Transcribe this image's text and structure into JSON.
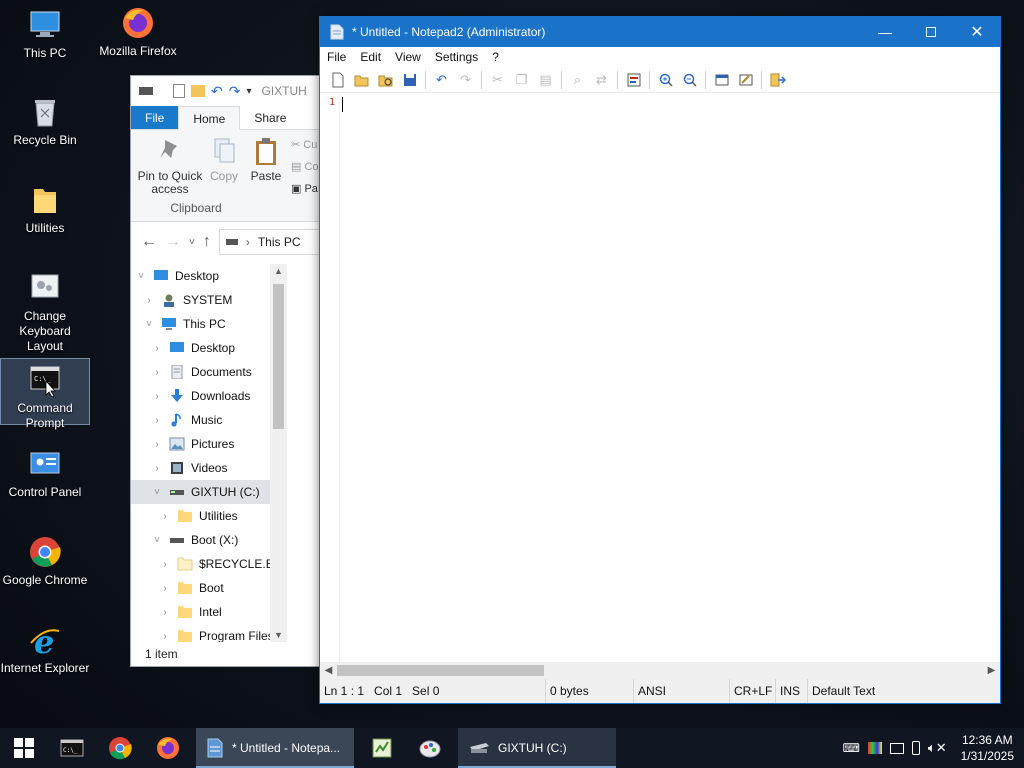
{
  "desktop": {
    "icons": [
      {
        "label": "This PC",
        "icon": "this-pc-icon"
      },
      {
        "label": "Mozilla Firefox",
        "icon": "firefox-icon"
      },
      {
        "label": "Recycle Bin",
        "icon": "recycle-bin-icon"
      },
      {
        "label": "Utilities",
        "icon": "folder-icon"
      },
      {
        "label": "Change Keyboard Layout",
        "icon": "keyboard-settings-icon"
      },
      {
        "label": "Command Prompt",
        "icon": "command-prompt-icon"
      },
      {
        "label": "Control Panel",
        "icon": "control-panel-icon"
      },
      {
        "label": "Google Chrome",
        "icon": "chrome-icon"
      },
      {
        "label": "Internet Explorer",
        "icon": "internet-explorer-icon"
      }
    ]
  },
  "explorer": {
    "qat_title": "GIXTUH",
    "tabs": {
      "file": "File",
      "home": "Home",
      "share": "Share"
    },
    "ribbon": {
      "pin_label": "Pin to Quick access",
      "copy_label": "Copy",
      "paste_label": "Paste",
      "cut_short": "Cu",
      "copy_path_short": "Co",
      "paste_shortcut_short": "Pa",
      "group_label": "Clipboard"
    },
    "address": {
      "location": "This PC"
    },
    "tree": [
      {
        "label": "Desktop",
        "level": 0,
        "chev": "˅"
      },
      {
        "label": "SYSTEM",
        "level": 1,
        "chev": "›"
      },
      {
        "label": "This PC",
        "level": 1,
        "chev": "˅"
      },
      {
        "label": "Desktop",
        "level": 2,
        "chev": "›"
      },
      {
        "label": "Documents",
        "level": 2,
        "chev": "›"
      },
      {
        "label": "Downloads",
        "level": 2,
        "chev": "›"
      },
      {
        "label": "Music",
        "level": 2,
        "chev": "›"
      },
      {
        "label": "Pictures",
        "level": 2,
        "chev": "›"
      },
      {
        "label": "Videos",
        "level": 2,
        "chev": "›"
      },
      {
        "label": "GIXTUH (C:)",
        "level": 2,
        "chev": "˅",
        "selected": true
      },
      {
        "label": "Utilities",
        "level": 3,
        "chev": "›"
      },
      {
        "label": "Boot (X:)",
        "level": 2,
        "chev": "˅"
      },
      {
        "label": "$RECYCLE.BIN",
        "level": 3,
        "chev": "›"
      },
      {
        "label": "Boot",
        "level": 3,
        "chev": "›"
      },
      {
        "label": "Intel",
        "level": 3,
        "chev": "›"
      },
      {
        "label": "Program Files",
        "level": 3,
        "chev": "›"
      }
    ],
    "status": "1 item"
  },
  "notepad": {
    "title": "* Untitled - Notepad2 (Administrator)",
    "menu": [
      "File",
      "Edit",
      "View",
      "Settings",
      "?"
    ],
    "line_number": "1",
    "status": {
      "position": "Ln 1 : 1   Col 1   Sel 0",
      "size": "0 bytes",
      "encoding": "ANSI",
      "eol": "CR+LF",
      "mode": "INS",
      "scheme": "Default Text"
    }
  },
  "taskbar": {
    "apps": [
      {
        "label": "* Untitled - Notepa...",
        "state": "active"
      },
      {
        "label": "GIXTUH (C:)",
        "state": "open"
      }
    ],
    "clock": {
      "time": "12:36 AM",
      "date": "1/31/2025"
    }
  },
  "colors": {
    "title_bar": "#1a73c8",
    "taskbar": "#101722",
    "ribbon_file_tab": "#1979ca",
    "line_number": "#c42b1c"
  }
}
